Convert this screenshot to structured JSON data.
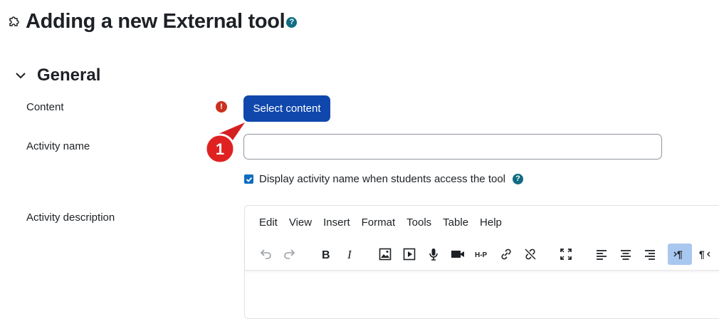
{
  "page": {
    "title": "Adding a new External tool"
  },
  "icons": {
    "title": "puzzle-icon",
    "help": "help-icon",
    "section_toggle": "chevron-down-icon",
    "required": "required-icon"
  },
  "section": {
    "title": "General"
  },
  "form": {
    "content_label": "Content",
    "select_content_label": "Select content",
    "activity_name_label": "Activity name",
    "activity_name_value": "",
    "display_name_label": "Display activity name when students access the tool",
    "display_name_checked": true,
    "activity_description_label": "Activity description"
  },
  "editor": {
    "menu": [
      "Edit",
      "View",
      "Insert",
      "Format",
      "Tools",
      "Table",
      "Help"
    ],
    "toolbar": [
      "undo",
      "redo",
      "bold",
      "italic",
      "image",
      "media",
      "record-audio",
      "record-video",
      "h5p",
      "link",
      "unlink",
      "fullscreen",
      "align-left",
      "align-center",
      "align-right",
      "ltr",
      "rtl"
    ]
  },
  "callout": {
    "number": "1"
  },
  "colors": {
    "primary": "#0f47ad",
    "help": "#0f6c82",
    "required": "#ca3120",
    "callout": "#d42020"
  }
}
